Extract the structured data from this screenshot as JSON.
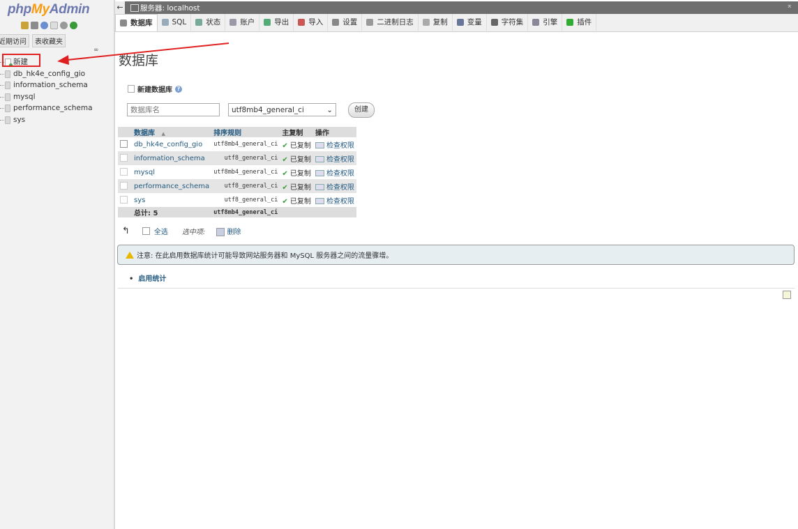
{
  "sidebar": {
    "logo": {
      "php": "php",
      "my": "My",
      "admin": "Admin"
    },
    "nav_icons": [
      "home-icon",
      "logout-icon",
      "help-icon",
      "docs-icon",
      "settings-icon",
      "reload-icon"
    ],
    "tabs": [
      "近期访问",
      "表收藏夹"
    ],
    "link_icon": "∞",
    "tree": [
      {
        "label": "新建",
        "type": "new"
      },
      {
        "label": "db_hk4e_config_gio",
        "type": "db"
      },
      {
        "label": "information_schema",
        "type": "db"
      },
      {
        "label": "mysql",
        "type": "db"
      },
      {
        "label": "performance_schema",
        "type": "db"
      },
      {
        "label": "sys",
        "type": "db"
      }
    ]
  },
  "topbar": {
    "back": "←",
    "title": "服务器: localhost",
    "collapse": "⌅"
  },
  "tabs": [
    {
      "label": "数据库",
      "active": true,
      "color": "#8a8a8a"
    },
    {
      "label": "SQL",
      "color": "#9ab"
    },
    {
      "label": "状态",
      "color": "#7a9"
    },
    {
      "label": "账户",
      "color": "#99a"
    },
    {
      "label": "导出",
      "color": "#5a7"
    },
    {
      "label": "导入",
      "color": "#c55"
    },
    {
      "label": "设置",
      "color": "#888"
    },
    {
      "label": "二进制日志",
      "color": "#999"
    },
    {
      "label": "复制",
      "color": "#aaa"
    },
    {
      "label": "变量",
      "color": "#679"
    },
    {
      "label": "字符集",
      "color": "#666"
    },
    {
      "label": "引擎",
      "color": "#889"
    },
    {
      "label": "插件",
      "color": "#3a3"
    }
  ],
  "main": {
    "title": "数据库",
    "new_db_label": "新建数据库",
    "help": "?",
    "dbname_placeholder": "数据库名",
    "collation_selected": "utf8mb4_general_ci",
    "create_button": "创建",
    "table": {
      "headers": [
        "数据库",
        "排序规则",
        "主复制",
        "操作"
      ],
      "sort_indicator": "▲",
      "rows": [
        {
          "name": "db_hk4e_config_gio",
          "collation": "utf8mb4_general_ci",
          "replication": "已复制",
          "action": "检查权限"
        },
        {
          "name": "information_schema",
          "collation": "utf8_general_ci",
          "replication": "已复制",
          "action": "检查权限"
        },
        {
          "name": "mysql",
          "collation": "utf8mb4_general_ci",
          "replication": "已复制",
          "action": "检查权限"
        },
        {
          "name": "performance_schema",
          "collation": "utf8_general_ci",
          "replication": "已复制",
          "action": "检查权限"
        },
        {
          "name": "sys",
          "collation": "utf8_general_ci",
          "replication": "已复制",
          "action": "检查权限"
        }
      ],
      "total_label": "总计: 5",
      "total_collation": "utf8mb4_general_ci"
    },
    "bulk": {
      "select_all": "全选",
      "with_selected": "选中项:",
      "delete": "删除"
    },
    "notice": "注意: 在此启用数据库统计可能导致网站服务器和 MySQL 服务器之间的流量骤增。",
    "enable_stats": "启用统计",
    "colors": {
      "accent": "#235a81",
      "annotation": "#e02020",
      "check": "#3c9b3c"
    }
  }
}
